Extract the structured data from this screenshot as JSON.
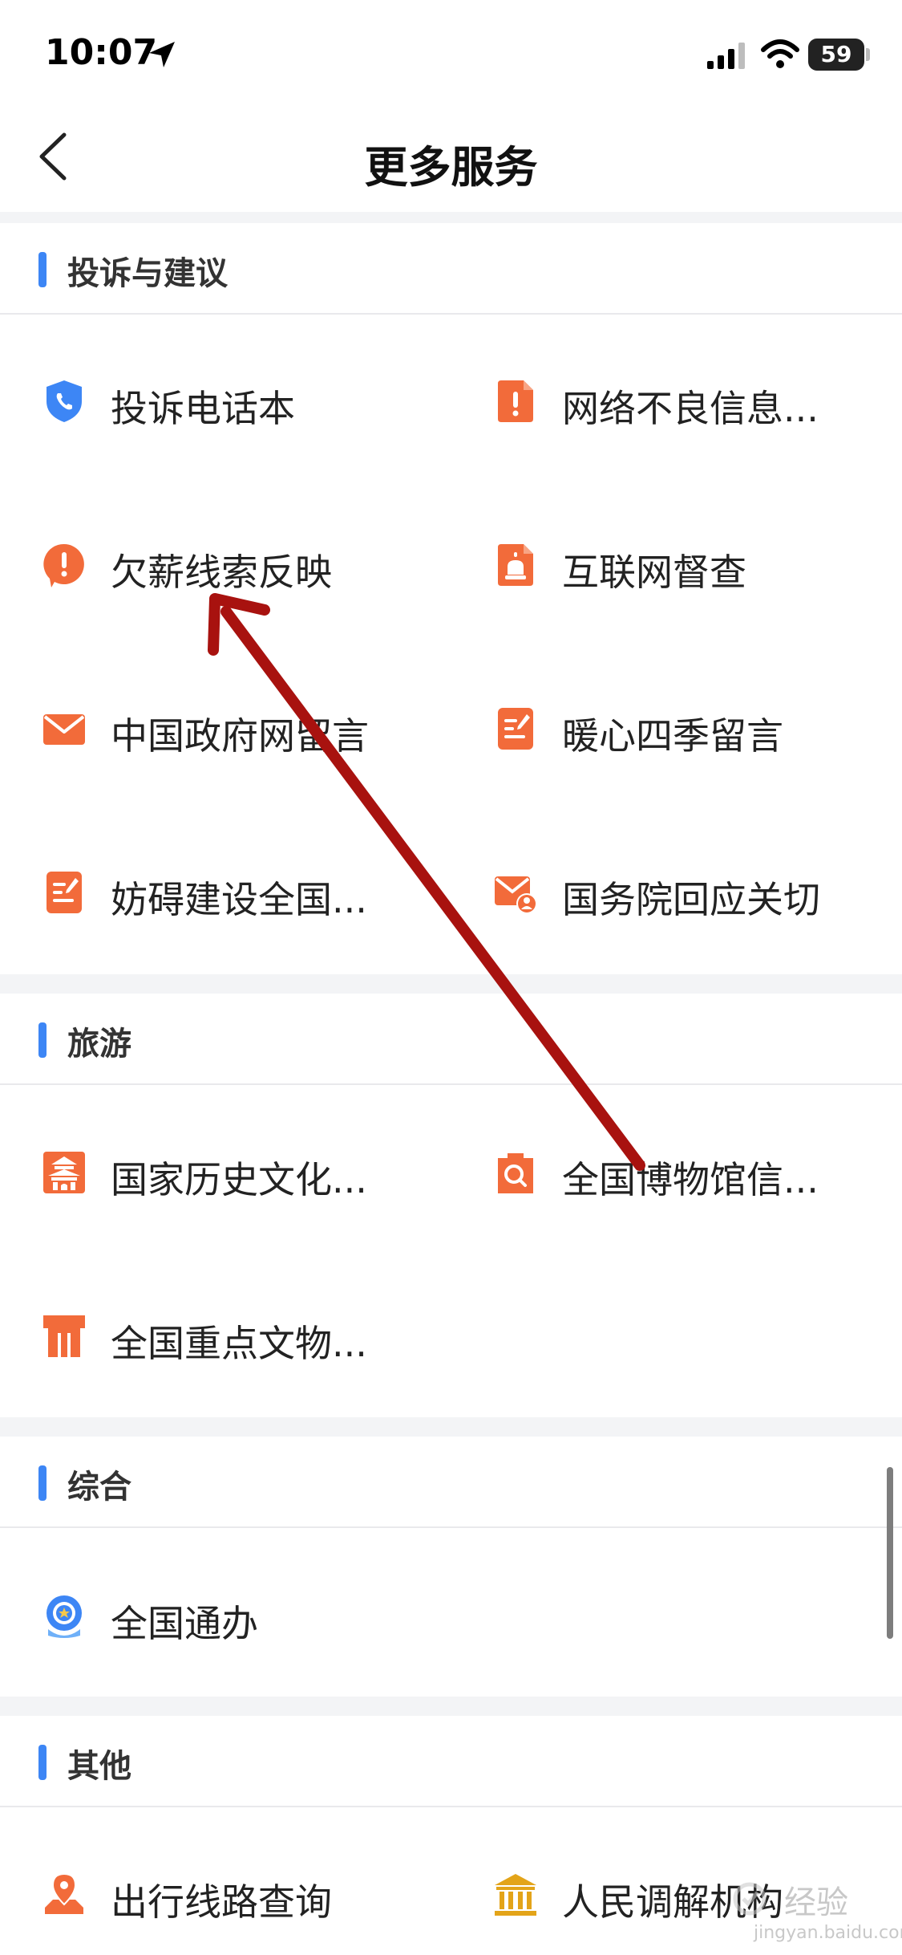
{
  "status_bar": {
    "time": "10:07",
    "battery": "59",
    "icons": [
      "location-arrow-icon",
      "signal-bars-icon",
      "wifi-icon",
      "battery-icon"
    ]
  },
  "nav": {
    "title": "更多服务",
    "back_icon": "chevron-left-icon"
  },
  "sections": [
    {
      "title": "投诉与建议",
      "items": [
        {
          "label": "投诉电话本",
          "icon": "shield-phone-icon"
        },
        {
          "label": "网络不良信息...",
          "icon": "document-alert-icon"
        },
        {
          "label": "欠薪线索反映",
          "icon": "alert-bubble-icon"
        },
        {
          "label": "互联网督查",
          "icon": "document-siren-icon"
        },
        {
          "label": "中国政府网留言",
          "icon": "envelope-icon"
        },
        {
          "label": "暖心四季留言",
          "icon": "document-pen-icon"
        },
        {
          "label": "妨碍建设全国...",
          "icon": "document-pen-icon"
        },
        {
          "label": "国务院回应关切",
          "icon": "envelope-user-icon"
        }
      ]
    },
    {
      "title": "旅游",
      "items": [
        {
          "label": "国家历史文化...",
          "icon": "temple-icon"
        },
        {
          "label": "全国博物馆信...",
          "icon": "museum-search-icon"
        },
        {
          "label": "全国重点文物...",
          "icon": "gate-icon"
        }
      ]
    },
    {
      "title": "综合",
      "items": [
        {
          "label": "全国通办",
          "icon": "national-service-icon"
        }
      ]
    },
    {
      "title": "其他",
      "items": [
        {
          "label": "出行线路查询",
          "icon": "map-pin-icon"
        },
        {
          "label": "人民调解机构",
          "icon": "institution-icon"
        }
      ]
    }
  ],
  "watermark": {
    "text": "经验",
    "sub": "jingyan.baidu.com"
  },
  "colors": {
    "accent_blue": "#3d86f5",
    "icon_orange": "#f26b3a",
    "icon_gold": "#e3a419",
    "annotation_red": "#a8120f",
    "divider_gray": "#f3f4f6"
  }
}
